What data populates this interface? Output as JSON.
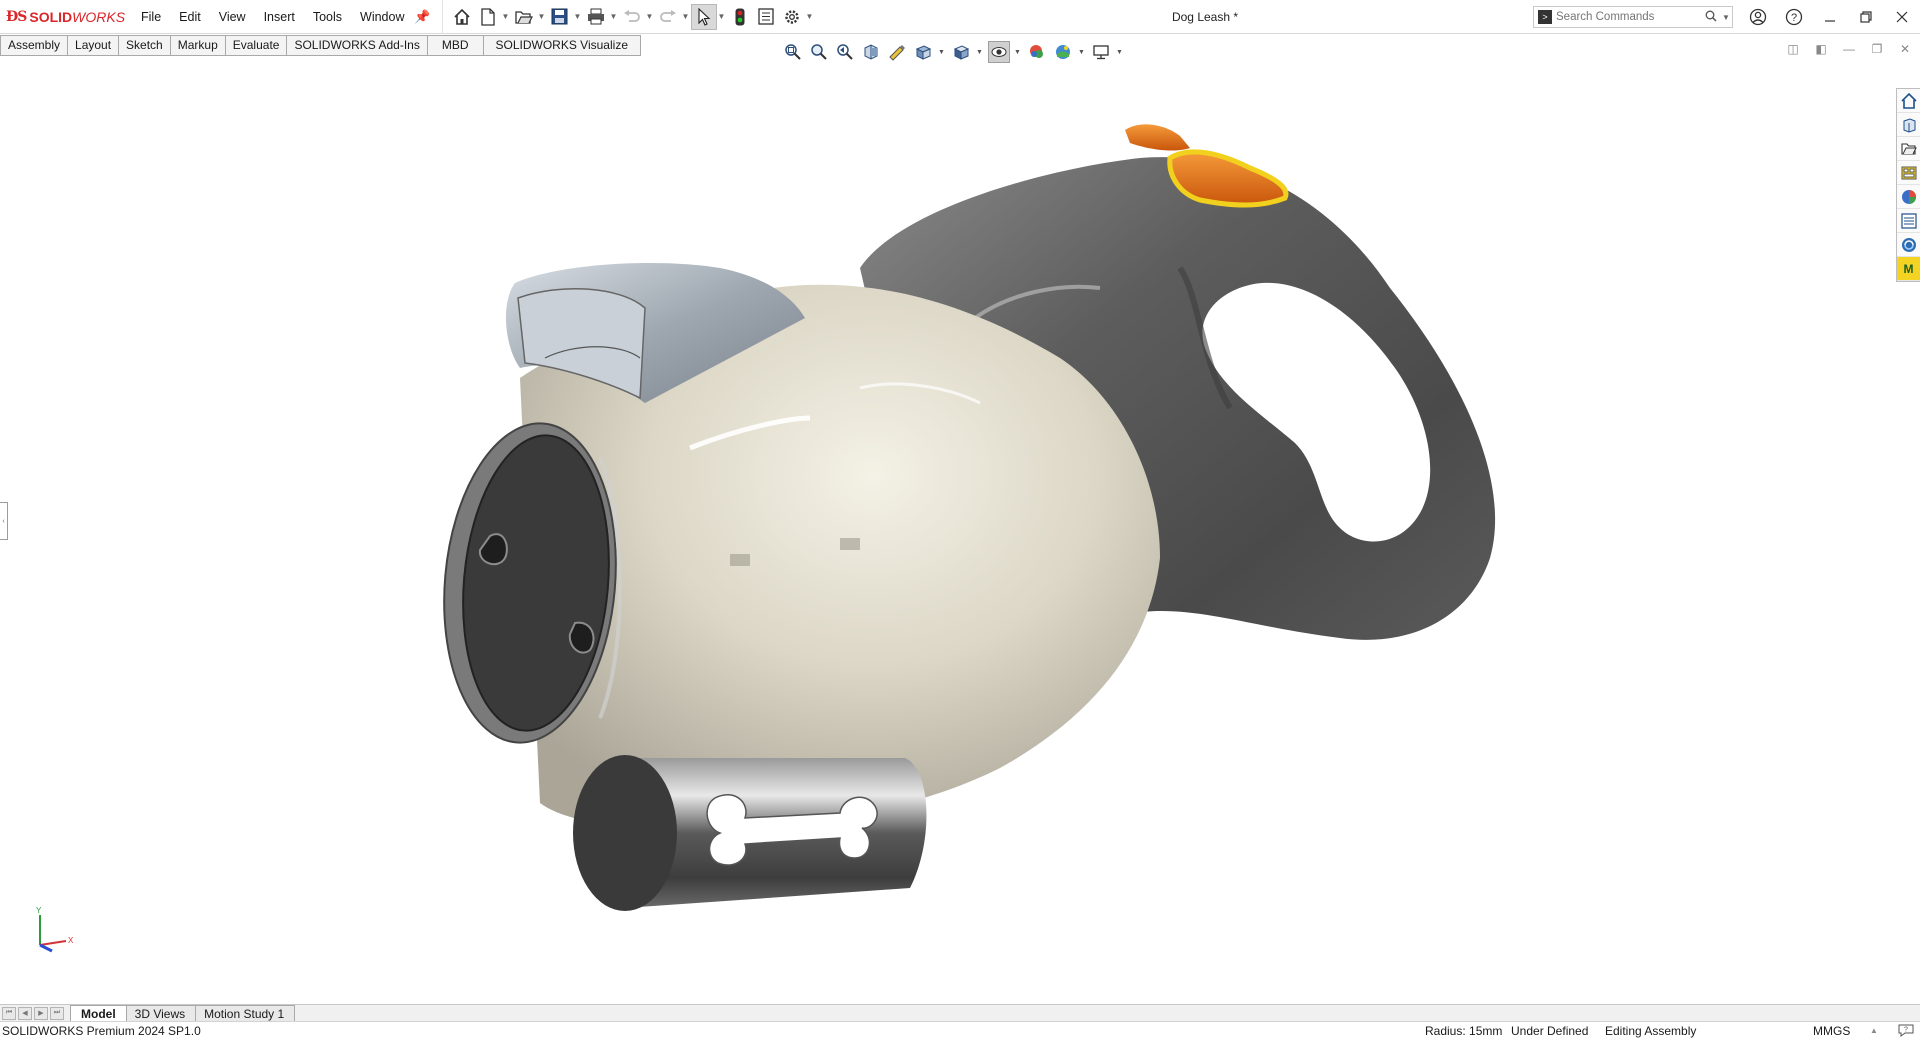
{
  "app": {
    "brand_bold": "SOLID",
    "brand_italic": "WORKS",
    "document_title": "Dog Leash *"
  },
  "menu": [
    "File",
    "Edit",
    "View",
    "Insert",
    "Tools",
    "Window"
  ],
  "search": {
    "placeholder": "Search Commands"
  },
  "command_tabs": [
    "Assembly",
    "Layout",
    "Sketch",
    "Markup",
    "Evaluate",
    "SOLIDWORKS Add-Ins",
    "MBD",
    "SOLIDWORKS Visualize"
  ],
  "bottom_tabs": [
    "Model",
    "3D Views",
    "Motion Study 1"
  ],
  "triad": {
    "y": "Y",
    "x": "X"
  },
  "status": {
    "product": "SOLIDWORKS Premium 2024 SP1.0",
    "radius": "Radius: 15mm",
    "definition": "Under Defined",
    "mode": "Editing Assembly",
    "units": "MMGS"
  },
  "colors": {
    "brand_red": "#d9262a",
    "body_cream": "#d8d3c3",
    "handle_gray": "#5a5a5a",
    "button_orange": "#e8731a",
    "selection_yellow": "#f2d11e"
  },
  "icons": {
    "quick_access": [
      "home-icon",
      "new-document-icon",
      "open-icon",
      "save-icon",
      "print-icon",
      "undo-icon",
      "redo-icon",
      "select-cursor-icon",
      "rebuild-traffic-light-icon",
      "file-properties-icon",
      "options-gear-icon"
    ],
    "heads_up": [
      "zoom-to-fit-icon",
      "zoom-to-area-icon",
      "previous-view-icon",
      "section-view-icon",
      "dynamic-annotation-icon",
      "view-orientation-icon",
      "display-style-icon",
      "hide-show-items-icon",
      "edit-appearance-icon",
      "apply-scene-icon",
      "view-settings-icon"
    ],
    "task_pane": [
      "solidworks-resources-icon",
      "design-library-icon",
      "file-explorer-icon",
      "view-palette-icon",
      "appearances-icon",
      "custom-properties-icon",
      "solidworks-forum-icon",
      "mbd-m-icon"
    ]
  }
}
